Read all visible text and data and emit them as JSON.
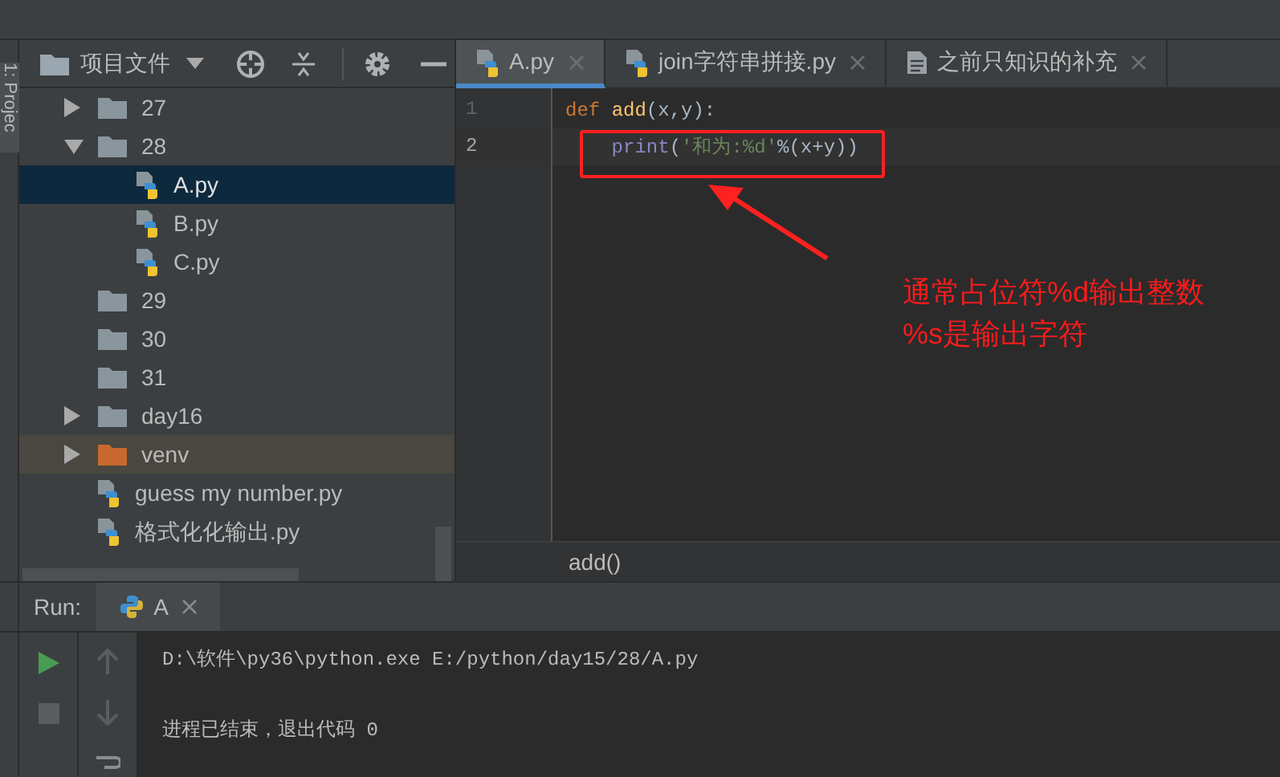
{
  "side_strip": {
    "label": "1: Projec"
  },
  "project_panel": {
    "title": "项目文件",
    "tree": [
      {
        "name": "27",
        "kind": "folder",
        "expanded": false,
        "selected": false
      },
      {
        "name": "28",
        "kind": "folder",
        "expanded": true,
        "selected": false,
        "children": [
          {
            "name": "A.py",
            "kind": "python",
            "selected": true
          },
          {
            "name": "B.py",
            "kind": "python",
            "selected": false
          },
          {
            "name": "C.py",
            "kind": "python",
            "selected": false
          }
        ]
      },
      {
        "name": "29",
        "kind": "folder",
        "selected": false
      },
      {
        "name": "30",
        "kind": "folder",
        "selected": false
      },
      {
        "name": "31",
        "kind": "folder",
        "selected": false
      },
      {
        "name": "day16",
        "kind": "folder",
        "expanded": false,
        "selected": false
      },
      {
        "name": "venv",
        "kind": "venv",
        "expanded": false,
        "selected": false
      },
      {
        "name": "guess my number.py",
        "kind": "python",
        "selected": false
      },
      {
        "name": "格式化化输出.py",
        "kind": "python",
        "selected": false
      }
    ]
  },
  "editor": {
    "tabs": [
      {
        "label": "A.py",
        "kind": "python",
        "selected": true
      },
      {
        "label": "join字符串拼接.py",
        "kind": "python",
        "selected": false
      },
      {
        "label": "之前只知识的补充",
        "kind": "text",
        "selected": false
      }
    ],
    "lines": [
      {
        "number": "1",
        "current": false,
        "tokens": [
          {
            "text": "def ",
            "kind": "keyword"
          },
          {
            "text": "add",
            "kind": "function"
          },
          {
            "text": "(x,y):",
            "kind": "plain"
          }
        ]
      },
      {
        "number": "2",
        "current": true,
        "tokens": [
          {
            "text": "    print",
            "kind": "builtin"
          },
          {
            "text": "(",
            "kind": "plain"
          },
          {
            "text": "'和为:%d'",
            "kind": "string"
          },
          {
            "text": "%(x+y))",
            "kind": "plain"
          }
        ]
      }
    ],
    "breadcrumb": "add()"
  },
  "annotation": {
    "lines": [
      "通常占位符%d输出整数",
      "%s是输出字符"
    ]
  },
  "run_panel": {
    "label": "Run:",
    "tab": "A",
    "output": [
      "D:\\软件\\py36\\python.exe E:/python/day15/28/A.py",
      "进程已结束，退出代码 0"
    ]
  }
}
